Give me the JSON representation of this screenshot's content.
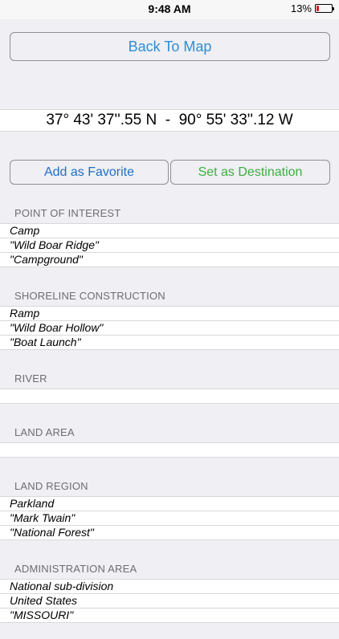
{
  "status_bar": {
    "time": "9:48 AM",
    "battery_percent_label": "13%"
  },
  "back_button": {
    "label": "Back To Map"
  },
  "coordinates": {
    "text": "37° 43' 37''.55 N  -  90° 55' 33''.12 W"
  },
  "actions": {
    "favorite_label": "Add as Favorite",
    "destination_label": "Set as Destination"
  },
  "sections": [
    {
      "title": "POINT OF INTEREST",
      "rows": [
        "Camp",
        "\"Wild Boar Ridge\"",
        "\"Campground\""
      ]
    },
    {
      "title": "SHORELINE CONSTRUCTION",
      "rows": [
        "Ramp",
        "\"Wild Boar Hollow\"",
        "\"Boat Launch\""
      ]
    },
    {
      "title": "RIVER",
      "rows": [
        ""
      ]
    },
    {
      "title": "LAND AREA",
      "rows": [
        ""
      ]
    },
    {
      "title": "LAND REGION",
      "rows": [
        "Parkland",
        "\"Mark Twain\"",
        "\"National Forest\""
      ]
    },
    {
      "title": "ADMINISTRATION AREA",
      "rows": [
        "National sub-division",
        "United States",
        "\"MISSOURI\""
      ]
    }
  ],
  "colors": {
    "background": "#efeff4",
    "link_blue": "#2f8ed6",
    "favorite_blue": "#1f6fc6",
    "destination_green": "#3fae3f",
    "battery_red": "#e0191f"
  }
}
